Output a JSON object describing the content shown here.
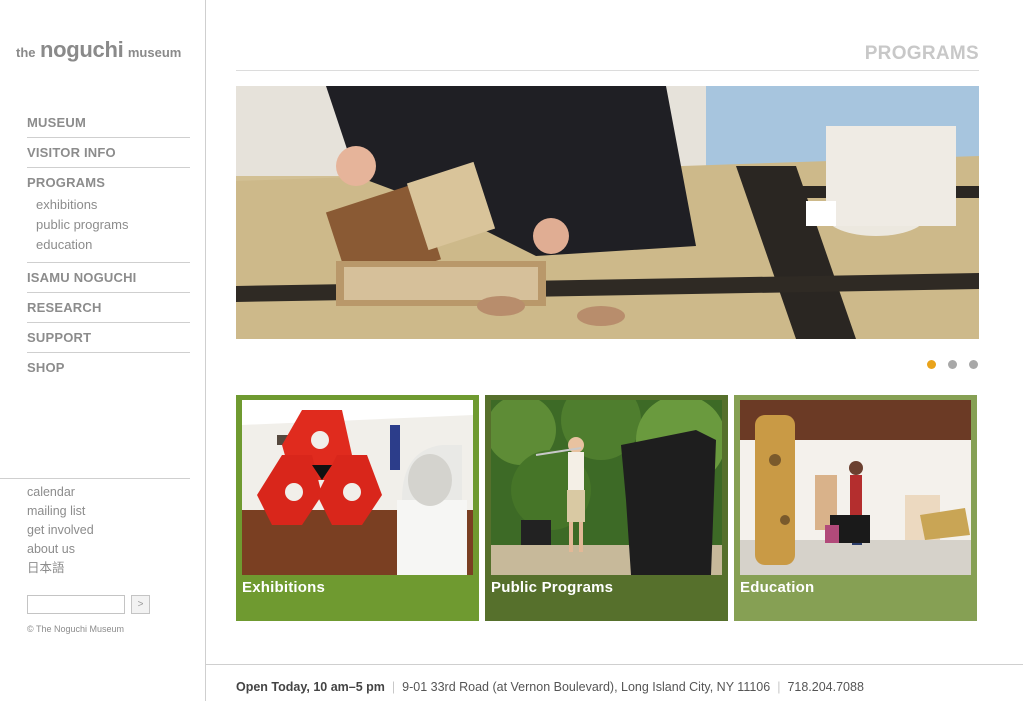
{
  "logo": {
    "prefix": "the",
    "name": "noguchi",
    "suffix": "museum"
  },
  "nav": {
    "museum": "MUSEUM",
    "visitor_info": "VISITOR INFO",
    "programs": "PROGRAMS",
    "programs_sub": [
      "exhibitions",
      "public programs",
      "education"
    ],
    "isamu_noguchi": "ISAMU NOGUCHI",
    "research": "RESEARCH",
    "support": "SUPPORT",
    "shop": "SHOP"
  },
  "utility": [
    "calendar",
    "mailing list",
    "get involved",
    "about us",
    "日本語"
  ],
  "search": {
    "value": "",
    "button": ">"
  },
  "copyright": "© The Noguchi Museum",
  "page_title": "PROGRAMS",
  "slideshow": {
    "count": 3,
    "active": 0
  },
  "tiles": [
    {
      "label": "Exhibitions",
      "color": "#6f9a30"
    },
    {
      "label": "Public Programs",
      "color": "#56702c"
    },
    {
      "label": "Education",
      "color": "#86a054"
    }
  ],
  "footer": {
    "hours": "Open Today, 10 am–5 pm",
    "address": "9-01 33rd Road (at Vernon Boulevard), Long Island City, NY 11106",
    "phone": "718.204.7088"
  },
  "colors": {
    "accent_dot": "#e9a31b",
    "inactive_dot": "#a8a8a8",
    "nav_text": "#8c8c8c"
  }
}
